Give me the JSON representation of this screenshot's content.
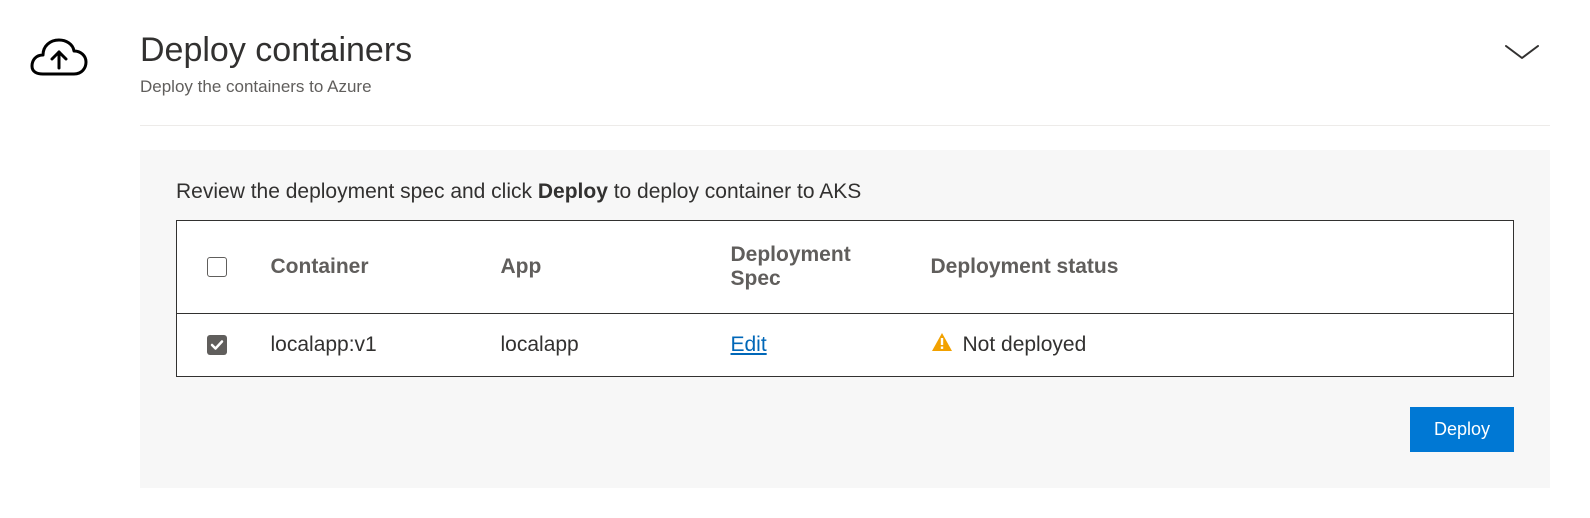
{
  "header": {
    "title": "Deploy containers",
    "subtitle": "Deploy the containers to Azure"
  },
  "panel": {
    "instruction_pre": "Review the deployment spec and click ",
    "instruction_bold": "Deploy",
    "instruction_post": " to deploy container to AKS",
    "columns": {
      "container": "Container",
      "app": "App",
      "spec": "Deployment Spec",
      "status": "Deployment status"
    },
    "rows": [
      {
        "checked": true,
        "container": "localapp:v1",
        "app": "localapp",
        "spec_link": "Edit",
        "status": "Not deployed"
      }
    ],
    "deploy_button": "Deploy"
  }
}
